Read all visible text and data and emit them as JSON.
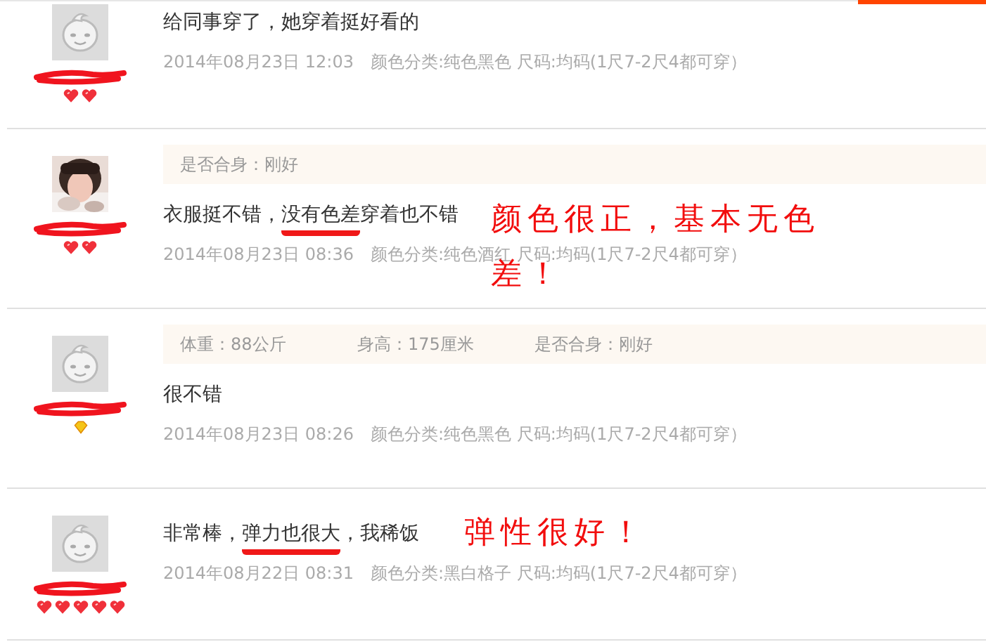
{
  "reviews": [
    {
      "avatar": {
        "kind": "default"
      },
      "rank_badges": [
        {
          "kind": "heart"
        },
        {
          "kind": "heart"
        }
      ],
      "text_parts": [
        {
          "text": "给同事穿了，她穿着挺好看的",
          "underlined": false
        }
      ],
      "date": "2014年08月23日 12:03",
      "attrs": "颜色分类:纯色黑色  尺码:均码(1尺7-2尺4都可穿）"
    },
    {
      "avatar": {
        "kind": "picture"
      },
      "rank_badges": [
        {
          "kind": "heart"
        },
        {
          "kind": "heart"
        }
      ],
      "details": [
        "是否合身：刚好"
      ],
      "text_parts": [
        {
          "text": "衣服挺不错，",
          "underlined": false
        },
        {
          "text": "没有色差",
          "underlined": true
        },
        {
          "text": "穿着也不错",
          "underlined": false
        }
      ],
      "date": "2014年08月23日 08:36",
      "attrs": "颜色分类:纯色酒红  尺码:均码(1尺7-2尺4都可穿）",
      "annotation": {
        "kind": "wide",
        "lines": [
          "颜色很正，基本无色",
          "差！"
        ]
      }
    },
    {
      "avatar": {
        "kind": "default"
      },
      "rank_badges": [
        {
          "kind": "diamond"
        }
      ],
      "details": [
        "体重：88公斤",
        "身高：175厘米",
        "是否合身：刚好"
      ],
      "text_parts": [
        {
          "text": "很不错",
          "underlined": false
        }
      ],
      "date": "2014年08月23日 08:26",
      "attrs": "颜色分类:纯色黑色  尺码:均码(1尺7-2尺4都可穿）"
    },
    {
      "avatar": {
        "kind": "default"
      },
      "rank_badges": [
        {
          "kind": "heart"
        },
        {
          "kind": "heart"
        },
        {
          "kind": "heart"
        },
        {
          "kind": "heart"
        },
        {
          "kind": "heart"
        }
      ],
      "text_parts": [
        {
          "text": "非常棒，",
          "underlined": false
        },
        {
          "text": "弹力也很大",
          "underlined": true
        },
        {
          "text": "，我稀饭",
          "underlined": false
        }
      ],
      "date": "2014年08月22日 08:31",
      "attrs": "颜色分类:黑白格子  尺码:均码(1尺7-2尺4都可穿）",
      "annotation": {
        "kind": "inline",
        "lines": [
          "弹性很好！"
        ]
      }
    }
  ]
}
